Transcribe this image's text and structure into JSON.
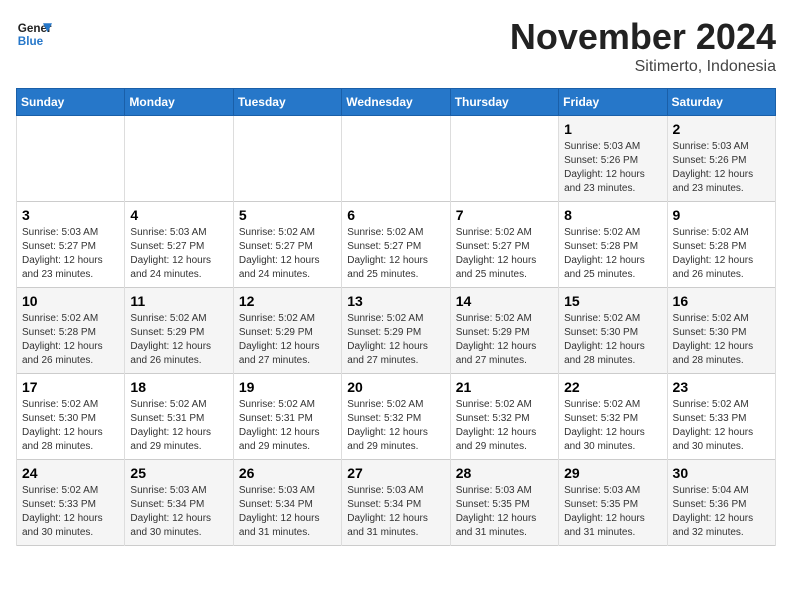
{
  "header": {
    "logo_line1": "General",
    "logo_line2": "Blue",
    "month": "November 2024",
    "location": "Sitimerto, Indonesia"
  },
  "weekdays": [
    "Sunday",
    "Monday",
    "Tuesday",
    "Wednesday",
    "Thursday",
    "Friday",
    "Saturday"
  ],
  "weeks": [
    [
      {
        "day": "",
        "info": ""
      },
      {
        "day": "",
        "info": ""
      },
      {
        "day": "",
        "info": ""
      },
      {
        "day": "",
        "info": ""
      },
      {
        "day": "",
        "info": ""
      },
      {
        "day": "1",
        "info": "Sunrise: 5:03 AM\nSunset: 5:26 PM\nDaylight: 12 hours\nand 23 minutes."
      },
      {
        "day": "2",
        "info": "Sunrise: 5:03 AM\nSunset: 5:26 PM\nDaylight: 12 hours\nand 23 minutes."
      }
    ],
    [
      {
        "day": "3",
        "info": "Sunrise: 5:03 AM\nSunset: 5:27 PM\nDaylight: 12 hours\nand 23 minutes."
      },
      {
        "day": "4",
        "info": "Sunrise: 5:03 AM\nSunset: 5:27 PM\nDaylight: 12 hours\nand 24 minutes."
      },
      {
        "day": "5",
        "info": "Sunrise: 5:02 AM\nSunset: 5:27 PM\nDaylight: 12 hours\nand 24 minutes."
      },
      {
        "day": "6",
        "info": "Sunrise: 5:02 AM\nSunset: 5:27 PM\nDaylight: 12 hours\nand 25 minutes."
      },
      {
        "day": "7",
        "info": "Sunrise: 5:02 AM\nSunset: 5:27 PM\nDaylight: 12 hours\nand 25 minutes."
      },
      {
        "day": "8",
        "info": "Sunrise: 5:02 AM\nSunset: 5:28 PM\nDaylight: 12 hours\nand 25 minutes."
      },
      {
        "day": "9",
        "info": "Sunrise: 5:02 AM\nSunset: 5:28 PM\nDaylight: 12 hours\nand 26 minutes."
      }
    ],
    [
      {
        "day": "10",
        "info": "Sunrise: 5:02 AM\nSunset: 5:28 PM\nDaylight: 12 hours\nand 26 minutes."
      },
      {
        "day": "11",
        "info": "Sunrise: 5:02 AM\nSunset: 5:29 PM\nDaylight: 12 hours\nand 26 minutes."
      },
      {
        "day": "12",
        "info": "Sunrise: 5:02 AM\nSunset: 5:29 PM\nDaylight: 12 hours\nand 27 minutes."
      },
      {
        "day": "13",
        "info": "Sunrise: 5:02 AM\nSunset: 5:29 PM\nDaylight: 12 hours\nand 27 minutes."
      },
      {
        "day": "14",
        "info": "Sunrise: 5:02 AM\nSunset: 5:29 PM\nDaylight: 12 hours\nand 27 minutes."
      },
      {
        "day": "15",
        "info": "Sunrise: 5:02 AM\nSunset: 5:30 PM\nDaylight: 12 hours\nand 28 minutes."
      },
      {
        "day": "16",
        "info": "Sunrise: 5:02 AM\nSunset: 5:30 PM\nDaylight: 12 hours\nand 28 minutes."
      }
    ],
    [
      {
        "day": "17",
        "info": "Sunrise: 5:02 AM\nSunset: 5:30 PM\nDaylight: 12 hours\nand 28 minutes."
      },
      {
        "day": "18",
        "info": "Sunrise: 5:02 AM\nSunset: 5:31 PM\nDaylight: 12 hours\nand 29 minutes."
      },
      {
        "day": "19",
        "info": "Sunrise: 5:02 AM\nSunset: 5:31 PM\nDaylight: 12 hours\nand 29 minutes."
      },
      {
        "day": "20",
        "info": "Sunrise: 5:02 AM\nSunset: 5:32 PM\nDaylight: 12 hours\nand 29 minutes."
      },
      {
        "day": "21",
        "info": "Sunrise: 5:02 AM\nSunset: 5:32 PM\nDaylight: 12 hours\nand 29 minutes."
      },
      {
        "day": "22",
        "info": "Sunrise: 5:02 AM\nSunset: 5:32 PM\nDaylight: 12 hours\nand 30 minutes."
      },
      {
        "day": "23",
        "info": "Sunrise: 5:02 AM\nSunset: 5:33 PM\nDaylight: 12 hours\nand 30 minutes."
      }
    ],
    [
      {
        "day": "24",
        "info": "Sunrise: 5:02 AM\nSunset: 5:33 PM\nDaylight: 12 hours\nand 30 minutes."
      },
      {
        "day": "25",
        "info": "Sunrise: 5:03 AM\nSunset: 5:34 PM\nDaylight: 12 hours\nand 30 minutes."
      },
      {
        "day": "26",
        "info": "Sunrise: 5:03 AM\nSunset: 5:34 PM\nDaylight: 12 hours\nand 31 minutes."
      },
      {
        "day": "27",
        "info": "Sunrise: 5:03 AM\nSunset: 5:34 PM\nDaylight: 12 hours\nand 31 minutes."
      },
      {
        "day": "28",
        "info": "Sunrise: 5:03 AM\nSunset: 5:35 PM\nDaylight: 12 hours\nand 31 minutes."
      },
      {
        "day": "29",
        "info": "Sunrise: 5:03 AM\nSunset: 5:35 PM\nDaylight: 12 hours\nand 31 minutes."
      },
      {
        "day": "30",
        "info": "Sunrise: 5:04 AM\nSunset: 5:36 PM\nDaylight: 12 hours\nand 32 minutes."
      }
    ]
  ]
}
